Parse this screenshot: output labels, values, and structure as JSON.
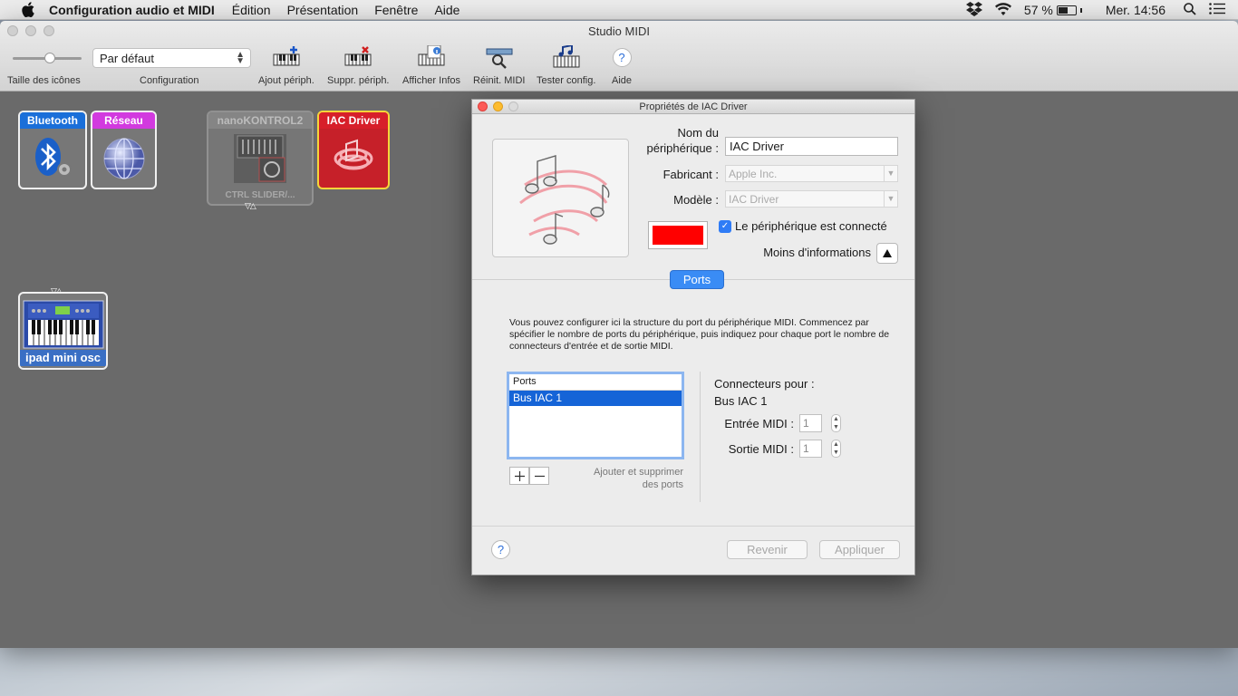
{
  "menubar": {
    "app_name": "Configuration audio et MIDI",
    "items": [
      "Édition",
      "Présentation",
      "Fenêtre",
      "Aide"
    ],
    "battery_percent": "57 %",
    "battery_level": 0.57,
    "clock": "Mer. 14:56"
  },
  "window": {
    "title": "Studio MIDI",
    "toolbar": {
      "icon_size_label": "Taille des icônes",
      "configuration_value": "Par défaut",
      "configuration_label": "Configuration",
      "add_device": "Ajout périph.",
      "remove_device": "Suppr. périph.",
      "show_info": "Afficher Infos",
      "reset_midi": "Réinit. MIDI",
      "test_setup": "Tester config.",
      "help": "Aide",
      "help_glyph": "?"
    }
  },
  "devices": {
    "bluetooth": "Bluetooth",
    "network": "Réseau",
    "nanokontrol": "nanoKONTROL2",
    "nanokontrol_sub": "CTRL SLIDER/...",
    "iac": "IAC Driver",
    "ipad": "ipad mini osc"
  },
  "dialog": {
    "title": "Propriétés de IAC Driver",
    "device_name_label_1": "Nom du",
    "device_name_label_2": "périphérique :",
    "device_name_value": "IAC Driver",
    "manufacturer_label": "Fabricant :",
    "manufacturer_value": "Apple Inc.",
    "model_label": "Modèle :",
    "model_value": "IAC Driver",
    "connected_label": "Le périphérique est connecté",
    "connected": true,
    "less_info": "Moins d'informations",
    "device_color": "#ff0000",
    "ports_tab": "Ports",
    "help_text": "Vous pouvez configurer ici la structure du port du périphérique MIDI. Commencez par spécifier le nombre de ports du périphérique, puis indiquez pour chaque port le nombre de connecteurs d'entrée et de sortie MIDI.",
    "ports_header": "Ports",
    "ports": [
      "Bus IAC 1"
    ],
    "add_remove_help_1": "Ajouter et supprimer",
    "add_remove_help_2": "des ports",
    "connectors_for": "Connecteurs pour :",
    "selected_port": "Bus IAC 1",
    "midi_in_label": "Entrée MIDI :",
    "midi_in_value": "1",
    "midi_out_label": "Sortie MIDI :",
    "midi_out_value": "1",
    "revert_button": "Revenir",
    "apply_button": "Appliquer",
    "help_glyph": "?"
  },
  "colors": {
    "accent": "#3a8cf5",
    "iac_red": "#d71f2a",
    "network_magenta": "#d23adf",
    "bluetooth_blue": "#1a6fd9"
  }
}
